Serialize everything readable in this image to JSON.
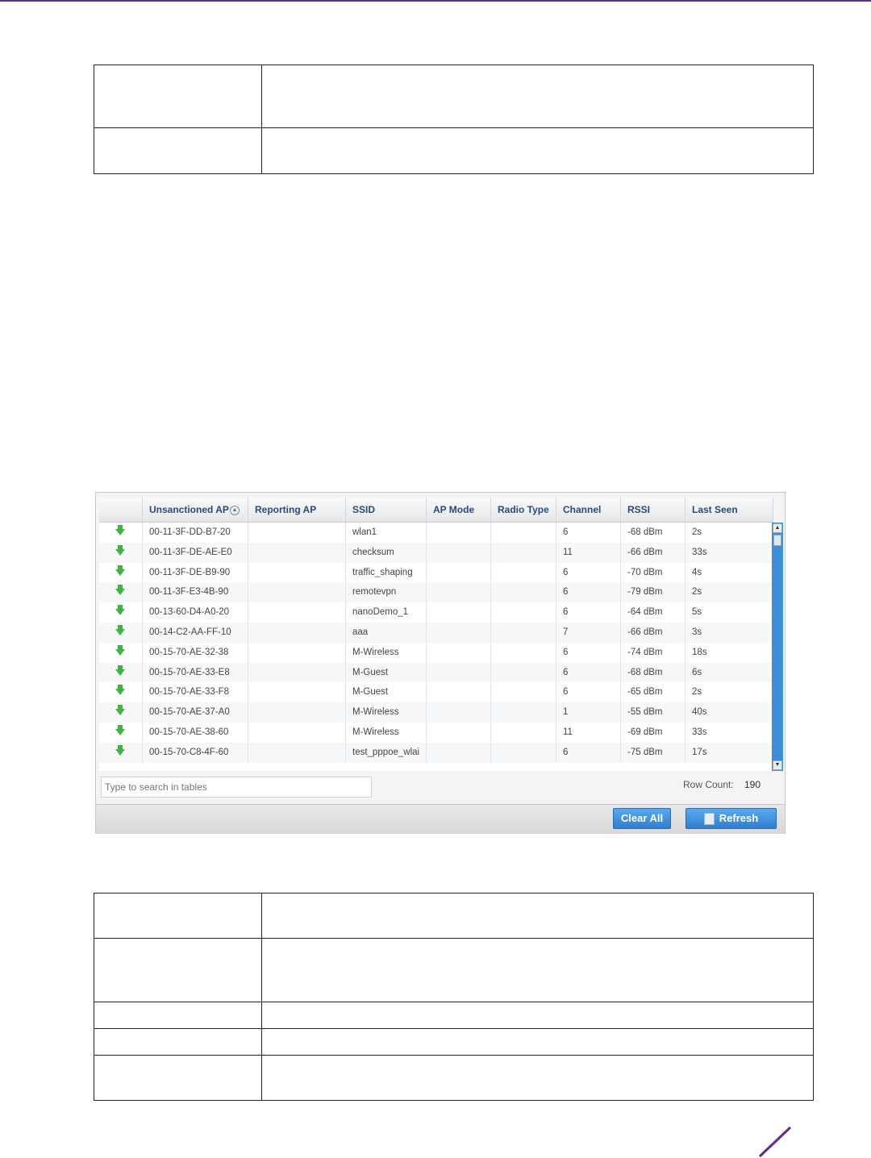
{
  "table": {
    "columns": [
      {
        "label": "",
        "sortable": false
      },
      {
        "label": "Unsanctioned AP",
        "sortable": true
      },
      {
        "label": "Reporting AP"
      },
      {
        "label": "SSID"
      },
      {
        "label": "AP Mode"
      },
      {
        "label": "Radio Type"
      },
      {
        "label": "Channel"
      },
      {
        "label": "RSSI"
      },
      {
        "label": "Last Seen"
      }
    ],
    "rows": [
      {
        "status_icon": "green-down-arrow-icon",
        "ap": "00-11-3F-DD-B7-20",
        "reporting": "",
        "ssid": "wlan1",
        "mode": "",
        "radio": "",
        "channel": "6",
        "rssi": "-68 dBm",
        "seen": "2s"
      },
      {
        "status_icon": "green-down-arrow-icon",
        "ap": "00-11-3F-DE-AE-E0",
        "reporting": "",
        "ssid": "checksum",
        "mode": "",
        "radio": "",
        "channel": "11",
        "rssi": "-66 dBm",
        "seen": "33s"
      },
      {
        "status_icon": "green-down-arrow-icon",
        "ap": "00-11-3F-DE-B9-90",
        "reporting": "",
        "ssid": "traffic_shaping",
        "mode": "",
        "radio": "",
        "channel": "6",
        "rssi": "-70 dBm",
        "seen": "4s"
      },
      {
        "status_icon": "green-down-arrow-icon",
        "ap": "00-11-3F-E3-4B-90",
        "reporting": "",
        "ssid": "remotevpn",
        "mode": "",
        "radio": "",
        "channel": "6",
        "rssi": "-79 dBm",
        "seen": "2s"
      },
      {
        "status_icon": "green-down-arrow-icon",
        "ap": "00-13-60-D4-A0-20",
        "reporting": "",
        "ssid": "nanoDemo_1",
        "mode": "",
        "radio": "",
        "channel": "6",
        "rssi": "-64 dBm",
        "seen": "5s"
      },
      {
        "status_icon": "green-down-arrow-icon",
        "ap": "00-14-C2-AA-FF-10",
        "reporting": "",
        "ssid": "aaa",
        "mode": "",
        "radio": "",
        "channel": "7",
        "rssi": "-66 dBm",
        "seen": "3s"
      },
      {
        "status_icon": "green-down-arrow-icon",
        "ap": "00-15-70-AE-32-38",
        "reporting": "",
        "ssid": "M-Wireless",
        "mode": "",
        "radio": "",
        "channel": "6",
        "rssi": "-74 dBm",
        "seen": "18s"
      },
      {
        "status_icon": "green-down-arrow-icon",
        "ap": "00-15-70-AE-33-E8",
        "reporting": "",
        "ssid": "M-Guest",
        "mode": "",
        "radio": "",
        "channel": "6",
        "rssi": "-68 dBm",
        "seen": "6s"
      },
      {
        "status_icon": "green-down-arrow-icon",
        "ap": "00-15-70-AE-33-F8",
        "reporting": "",
        "ssid": "M-Guest",
        "mode": "",
        "radio": "",
        "channel": "6",
        "rssi": "-65 dBm",
        "seen": "2s"
      },
      {
        "status_icon": "green-down-arrow-icon",
        "ap": "00-15-70-AE-37-A0",
        "reporting": "",
        "ssid": "M-Wireless",
        "mode": "",
        "radio": "",
        "channel": "1",
        "rssi": "-55 dBm",
        "seen": "40s"
      },
      {
        "status_icon": "green-down-arrow-icon",
        "ap": "00-15-70-AE-38-60",
        "reporting": "",
        "ssid": "M-Wireless",
        "mode": "",
        "radio": "",
        "channel": "11",
        "rssi": "-69 dBm",
        "seen": "33s"
      },
      {
        "status_icon": "green-down-arrow-icon",
        "ap": "00-15-70-C8-4F-60",
        "reporting": "",
        "ssid": "test_pppoe_wlai",
        "mode": "",
        "radio": "",
        "channel": "6",
        "rssi": "-75 dBm",
        "seen": "17s"
      }
    ]
  },
  "search": {
    "placeholder": "Type to search in tables"
  },
  "row_count": {
    "label": "Row Count:",
    "value": "190"
  },
  "buttons": {
    "clear_all": "Clear All",
    "refresh": "Refresh"
  },
  "colors": {
    "accent": "#5b2d8e",
    "header_text": "#2b4a7a",
    "button": "#3a8bdc",
    "status_arrow": "#3fb53f",
    "scrollbar": "#3b8ed8"
  }
}
